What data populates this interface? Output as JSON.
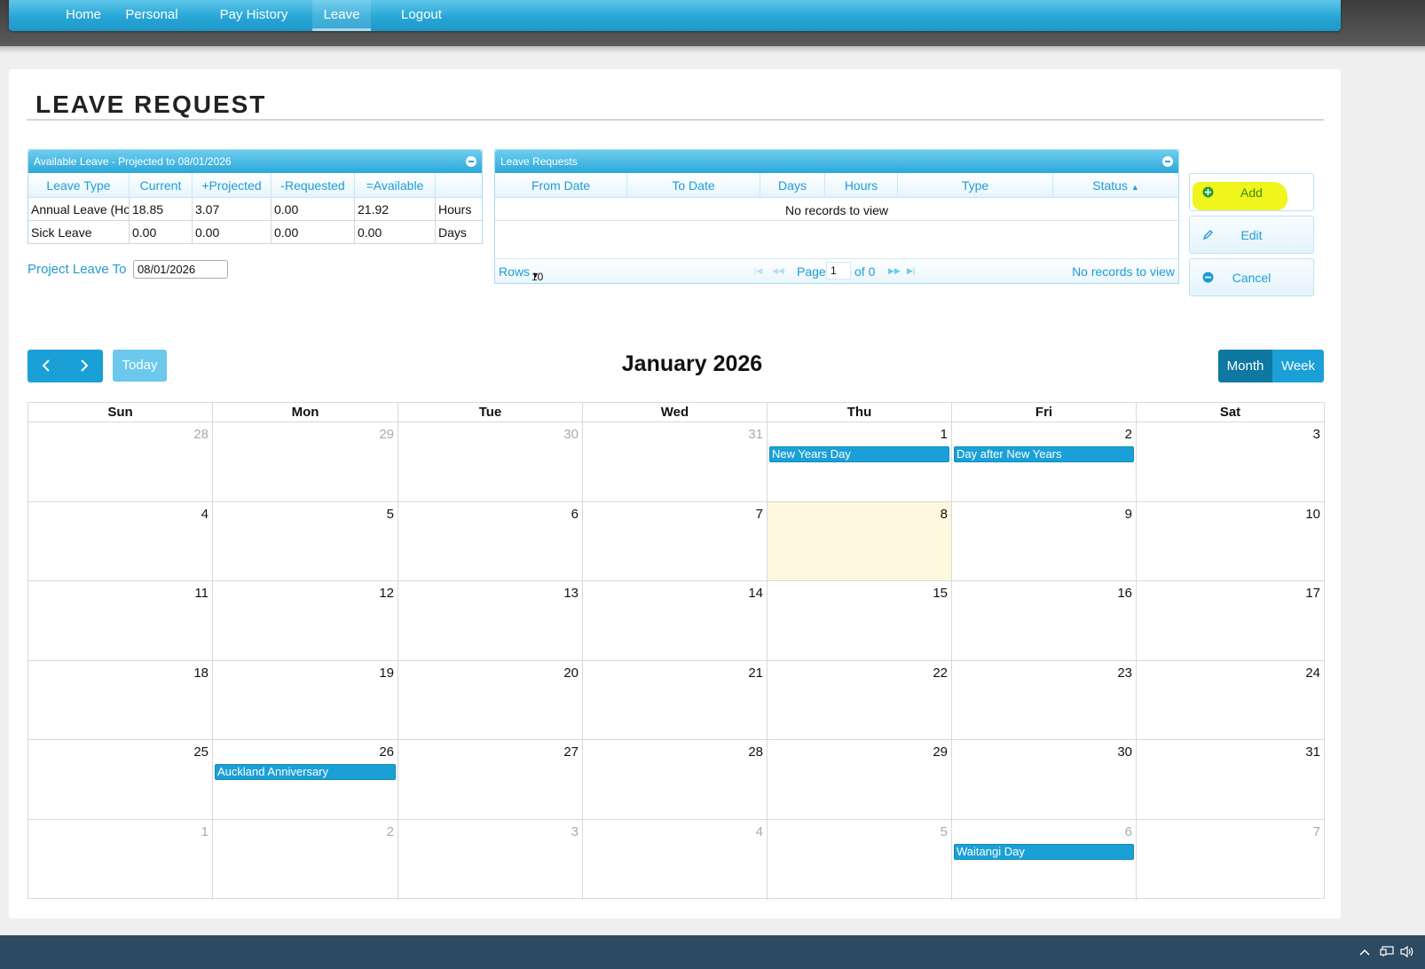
{
  "nav": {
    "items": [
      {
        "label": "Home"
      },
      {
        "label": "Personal"
      },
      {
        "label": "Pay History"
      },
      {
        "label": "Leave"
      },
      {
        "label": "Logout"
      }
    ],
    "active": "Leave"
  },
  "page": {
    "title": "LEAVE REQUEST"
  },
  "available_leave": {
    "caption": "Available Leave - Projected to 08/01/2026",
    "columns": [
      "Leave Type",
      "Current",
      "+Projected",
      "-Requested",
      "=Available",
      ""
    ],
    "rows": [
      [
        "Annual Leave (Ho",
        "18.85",
        "3.07",
        "0.00",
        "21.92",
        "Hours"
      ],
      [
        "Sick Leave",
        "0.00",
        "0.00",
        "0.00",
        "0.00",
        "Days"
      ]
    ]
  },
  "project_leave": {
    "label": "Project Leave To",
    "value": "08/01/2026"
  },
  "leave_requests": {
    "caption": "Leave Requests",
    "columns": [
      "From Date",
      "To Date",
      "Days",
      "Hours",
      "Type",
      "Status"
    ],
    "empty_text": "No records to view",
    "pager": {
      "rows_label": "Rows",
      "rows_value": "10",
      "page_label": "Page",
      "page_value": "1",
      "of_label": "of 0",
      "status": "No records to view"
    }
  },
  "actions": {
    "add": "Add",
    "edit": "Edit",
    "cancel": "Cancel"
  },
  "calendar": {
    "title": "January 2026",
    "today_label": "Today",
    "views": {
      "month": "Month",
      "week": "Week"
    },
    "active_view": "Month",
    "day_names": [
      "Sun",
      "Mon",
      "Tue",
      "Wed",
      "Thu",
      "Fri",
      "Sat"
    ],
    "weeks": [
      [
        {
          "d": "28",
          "o": true
        },
        {
          "d": "29",
          "o": true
        },
        {
          "d": "30",
          "o": true
        },
        {
          "d": "31",
          "o": true
        },
        {
          "d": "1",
          "ev": "New Years Day"
        },
        {
          "d": "2",
          "ev": "Day after New Years"
        },
        {
          "d": "3"
        }
      ],
      [
        {
          "d": "4"
        },
        {
          "d": "5"
        },
        {
          "d": "6"
        },
        {
          "d": "7"
        },
        {
          "d": "8",
          "today": true
        },
        {
          "d": "9"
        },
        {
          "d": "10"
        }
      ],
      [
        {
          "d": "11"
        },
        {
          "d": "12"
        },
        {
          "d": "13"
        },
        {
          "d": "14"
        },
        {
          "d": "15"
        },
        {
          "d": "16"
        },
        {
          "d": "17"
        }
      ],
      [
        {
          "d": "18"
        },
        {
          "d": "19"
        },
        {
          "d": "20"
        },
        {
          "d": "21"
        },
        {
          "d": "22"
        },
        {
          "d": "23"
        },
        {
          "d": "24"
        }
      ],
      [
        {
          "d": "25"
        },
        {
          "d": "26",
          "ev": "Auckland Anniversary"
        },
        {
          "d": "27"
        },
        {
          "d": "28"
        },
        {
          "d": "29"
        },
        {
          "d": "30"
        },
        {
          "d": "31"
        }
      ],
      [
        {
          "d": "1",
          "o": true
        },
        {
          "d": "2",
          "o": true
        },
        {
          "d": "3",
          "o": true
        },
        {
          "d": "4",
          "o": true
        },
        {
          "d": "5",
          "o": true
        },
        {
          "d": "6",
          "o": true,
          "ev": "Waitangi Day"
        },
        {
          "d": "7",
          "o": true
        }
      ]
    ]
  },
  "colors": {
    "accent": "#1aa0d7",
    "today_bg": "#fdf7dd",
    "highlight": "#f0f51c"
  }
}
